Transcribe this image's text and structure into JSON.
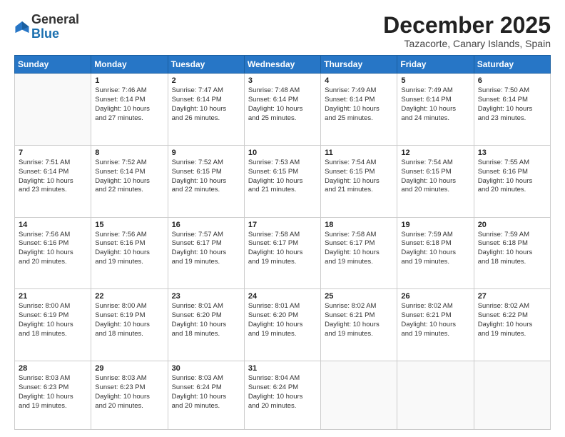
{
  "header": {
    "logo_general": "General",
    "logo_blue": "Blue",
    "month_title": "December 2025",
    "location": "Tazacorte, Canary Islands, Spain"
  },
  "days_of_week": [
    "Sunday",
    "Monday",
    "Tuesday",
    "Wednesday",
    "Thursday",
    "Friday",
    "Saturday"
  ],
  "weeks": [
    [
      {
        "day": "",
        "detail": ""
      },
      {
        "day": "1",
        "detail": "Sunrise: 7:46 AM\nSunset: 6:14 PM\nDaylight: 10 hours\nand 27 minutes."
      },
      {
        "day": "2",
        "detail": "Sunrise: 7:47 AM\nSunset: 6:14 PM\nDaylight: 10 hours\nand 26 minutes."
      },
      {
        "day": "3",
        "detail": "Sunrise: 7:48 AM\nSunset: 6:14 PM\nDaylight: 10 hours\nand 25 minutes."
      },
      {
        "day": "4",
        "detail": "Sunrise: 7:49 AM\nSunset: 6:14 PM\nDaylight: 10 hours\nand 25 minutes."
      },
      {
        "day": "5",
        "detail": "Sunrise: 7:49 AM\nSunset: 6:14 PM\nDaylight: 10 hours\nand 24 minutes."
      },
      {
        "day": "6",
        "detail": "Sunrise: 7:50 AM\nSunset: 6:14 PM\nDaylight: 10 hours\nand 23 minutes."
      }
    ],
    [
      {
        "day": "7",
        "detail": "Sunrise: 7:51 AM\nSunset: 6:14 PM\nDaylight: 10 hours\nand 23 minutes."
      },
      {
        "day": "8",
        "detail": "Sunrise: 7:52 AM\nSunset: 6:14 PM\nDaylight: 10 hours\nand 22 minutes."
      },
      {
        "day": "9",
        "detail": "Sunrise: 7:52 AM\nSunset: 6:15 PM\nDaylight: 10 hours\nand 22 minutes."
      },
      {
        "day": "10",
        "detail": "Sunrise: 7:53 AM\nSunset: 6:15 PM\nDaylight: 10 hours\nand 21 minutes."
      },
      {
        "day": "11",
        "detail": "Sunrise: 7:54 AM\nSunset: 6:15 PM\nDaylight: 10 hours\nand 21 minutes."
      },
      {
        "day": "12",
        "detail": "Sunrise: 7:54 AM\nSunset: 6:15 PM\nDaylight: 10 hours\nand 20 minutes."
      },
      {
        "day": "13",
        "detail": "Sunrise: 7:55 AM\nSunset: 6:16 PM\nDaylight: 10 hours\nand 20 minutes."
      }
    ],
    [
      {
        "day": "14",
        "detail": "Sunrise: 7:56 AM\nSunset: 6:16 PM\nDaylight: 10 hours\nand 20 minutes."
      },
      {
        "day": "15",
        "detail": "Sunrise: 7:56 AM\nSunset: 6:16 PM\nDaylight: 10 hours\nand 19 minutes."
      },
      {
        "day": "16",
        "detail": "Sunrise: 7:57 AM\nSunset: 6:17 PM\nDaylight: 10 hours\nand 19 minutes."
      },
      {
        "day": "17",
        "detail": "Sunrise: 7:58 AM\nSunset: 6:17 PM\nDaylight: 10 hours\nand 19 minutes."
      },
      {
        "day": "18",
        "detail": "Sunrise: 7:58 AM\nSunset: 6:17 PM\nDaylight: 10 hours\nand 19 minutes."
      },
      {
        "day": "19",
        "detail": "Sunrise: 7:59 AM\nSunset: 6:18 PM\nDaylight: 10 hours\nand 19 minutes."
      },
      {
        "day": "20",
        "detail": "Sunrise: 7:59 AM\nSunset: 6:18 PM\nDaylight: 10 hours\nand 18 minutes."
      }
    ],
    [
      {
        "day": "21",
        "detail": "Sunrise: 8:00 AM\nSunset: 6:19 PM\nDaylight: 10 hours\nand 18 minutes."
      },
      {
        "day": "22",
        "detail": "Sunrise: 8:00 AM\nSunset: 6:19 PM\nDaylight: 10 hours\nand 18 minutes."
      },
      {
        "day": "23",
        "detail": "Sunrise: 8:01 AM\nSunset: 6:20 PM\nDaylight: 10 hours\nand 18 minutes."
      },
      {
        "day": "24",
        "detail": "Sunrise: 8:01 AM\nSunset: 6:20 PM\nDaylight: 10 hours\nand 19 minutes."
      },
      {
        "day": "25",
        "detail": "Sunrise: 8:02 AM\nSunset: 6:21 PM\nDaylight: 10 hours\nand 19 minutes."
      },
      {
        "day": "26",
        "detail": "Sunrise: 8:02 AM\nSunset: 6:21 PM\nDaylight: 10 hours\nand 19 minutes."
      },
      {
        "day": "27",
        "detail": "Sunrise: 8:02 AM\nSunset: 6:22 PM\nDaylight: 10 hours\nand 19 minutes."
      }
    ],
    [
      {
        "day": "28",
        "detail": "Sunrise: 8:03 AM\nSunset: 6:23 PM\nDaylight: 10 hours\nand 19 minutes."
      },
      {
        "day": "29",
        "detail": "Sunrise: 8:03 AM\nSunset: 6:23 PM\nDaylight: 10 hours\nand 20 minutes."
      },
      {
        "day": "30",
        "detail": "Sunrise: 8:03 AM\nSunset: 6:24 PM\nDaylight: 10 hours\nand 20 minutes."
      },
      {
        "day": "31",
        "detail": "Sunrise: 8:04 AM\nSunset: 6:24 PM\nDaylight: 10 hours\nand 20 minutes."
      },
      {
        "day": "",
        "detail": ""
      },
      {
        "day": "",
        "detail": ""
      },
      {
        "day": "",
        "detail": ""
      }
    ]
  ]
}
